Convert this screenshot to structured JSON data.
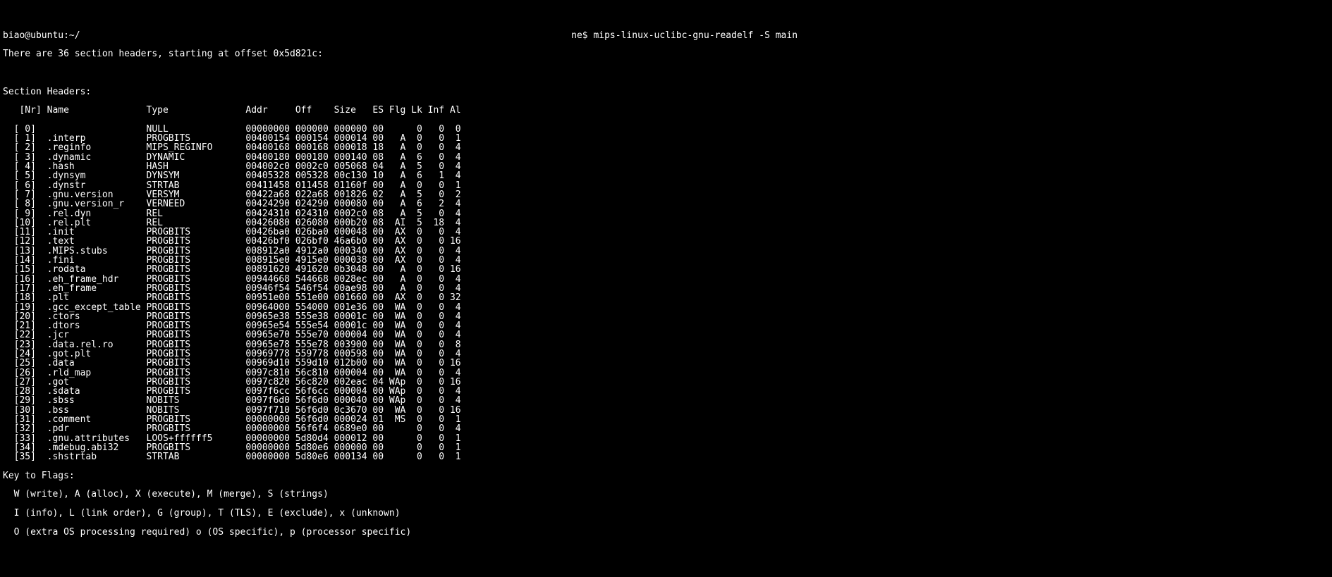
{
  "prompt_line": "biao@ubuntu:~/                                                                                         ne$ mips-linux-uclibc-gnu-readelf -S main",
  "summary_line": "There are 36 section headers, starting at offset 0x5d821c:",
  "section_headers_title": "Section Headers:",
  "header_labels": {
    "nr": "[Nr]",
    "name": "Name",
    "type": "Type",
    "addr": "Addr",
    "off": "Off",
    "size": "Size",
    "es": "ES",
    "flg": "Flg",
    "lk": "Lk",
    "inf": "Inf",
    "al": "Al"
  },
  "sections": [
    {
      "nr": "[ 0]",
      "name": "",
      "type": "NULL",
      "addr": "00000000",
      "off": "000000",
      "size": "000000",
      "es": "00",
      "flg": "",
      "lk": "0",
      "inf": "0",
      "al": "0"
    },
    {
      "nr": "[ 1]",
      "name": ".interp",
      "type": "PROGBITS",
      "addr": "00400154",
      "off": "000154",
      "size": "000014",
      "es": "00",
      "flg": "A",
      "lk": "0",
      "inf": "0",
      "al": "1"
    },
    {
      "nr": "[ 2]",
      "name": ".reginfo",
      "type": "MIPS_REGINFO",
      "addr": "00400168",
      "off": "000168",
      "size": "000018",
      "es": "18",
      "flg": "A",
      "lk": "0",
      "inf": "0",
      "al": "4"
    },
    {
      "nr": "[ 3]",
      "name": ".dynamic",
      "type": "DYNAMIC",
      "addr": "00400180",
      "off": "000180",
      "size": "000140",
      "es": "08",
      "flg": "A",
      "lk": "6",
      "inf": "0",
      "al": "4"
    },
    {
      "nr": "[ 4]",
      "name": ".hash",
      "type": "HASH",
      "addr": "004002c0",
      "off": "0002c0",
      "size": "005068",
      "es": "04",
      "flg": "A",
      "lk": "5",
      "inf": "0",
      "al": "4"
    },
    {
      "nr": "[ 5]",
      "name": ".dynsym",
      "type": "DYNSYM",
      "addr": "00405328",
      "off": "005328",
      "size": "00c130",
      "es": "10",
      "flg": "A",
      "lk": "6",
      "inf": "1",
      "al": "4"
    },
    {
      "nr": "[ 6]",
      "name": ".dynstr",
      "type": "STRTAB",
      "addr": "00411458",
      "off": "011458",
      "size": "01160f",
      "es": "00",
      "flg": "A",
      "lk": "0",
      "inf": "0",
      "al": "1"
    },
    {
      "nr": "[ 7]",
      "name": ".gnu.version",
      "type": "VERSYM",
      "addr": "00422a68",
      "off": "022a68",
      "size": "001826",
      "es": "02",
      "flg": "A",
      "lk": "5",
      "inf": "0",
      "al": "2"
    },
    {
      "nr": "[ 8]",
      "name": ".gnu.version_r",
      "type": "VERNEED",
      "addr": "00424290",
      "off": "024290",
      "size": "000080",
      "es": "00",
      "flg": "A",
      "lk": "6",
      "inf": "2",
      "al": "4"
    },
    {
      "nr": "[ 9]",
      "name": ".rel.dyn",
      "type": "REL",
      "addr": "00424310",
      "off": "024310",
      "size": "0002c0",
      "es": "08",
      "flg": "A",
      "lk": "5",
      "inf": "0",
      "al": "4"
    },
    {
      "nr": "[10]",
      "name": ".rel.plt",
      "type": "REL",
      "addr": "00426080",
      "off": "026080",
      "size": "000b20",
      "es": "08",
      "flg": "AI",
      "lk": "5",
      "inf": "18",
      "al": "4"
    },
    {
      "nr": "[11]",
      "name": ".init",
      "type": "PROGBITS",
      "addr": "00426ba0",
      "off": "026ba0",
      "size": "000048",
      "es": "00",
      "flg": "AX",
      "lk": "0",
      "inf": "0",
      "al": "4"
    },
    {
      "nr": "[12]",
      "name": ".text",
      "type": "PROGBITS",
      "addr": "00426bf0",
      "off": "026bf0",
      "size": "46a6b0",
      "es": "00",
      "flg": "AX",
      "lk": "0",
      "inf": "0",
      "al": "16"
    },
    {
      "nr": "[13]",
      "name": ".MIPS.stubs",
      "type": "PROGBITS",
      "addr": "008912a0",
      "off": "4912a0",
      "size": "000340",
      "es": "00",
      "flg": "AX",
      "lk": "0",
      "inf": "0",
      "al": "4"
    },
    {
      "nr": "[14]",
      "name": ".fini",
      "type": "PROGBITS",
      "addr": "008915e0",
      "off": "4915e0",
      "size": "000038",
      "es": "00",
      "flg": "AX",
      "lk": "0",
      "inf": "0",
      "al": "4"
    },
    {
      "nr": "[15]",
      "name": ".rodata",
      "type": "PROGBITS",
      "addr": "00891620",
      "off": "491620",
      "size": "0b3048",
      "es": "00",
      "flg": "A",
      "lk": "0",
      "inf": "0",
      "al": "16"
    },
    {
      "nr": "[16]",
      "name": ".eh_frame_hdr",
      "type": "PROGBITS",
      "addr": "00944668",
      "off": "544668",
      "size": "0028ec",
      "es": "00",
      "flg": "A",
      "lk": "0",
      "inf": "0",
      "al": "4"
    },
    {
      "nr": "[17]",
      "name": ".eh_frame",
      "type": "PROGBITS",
      "addr": "00946f54",
      "off": "546f54",
      "size": "00ae98",
      "es": "00",
      "flg": "A",
      "lk": "0",
      "inf": "0",
      "al": "4"
    },
    {
      "nr": "[18]",
      "name": ".plt",
      "type": "PROGBITS",
      "addr": "00951e00",
      "off": "551e00",
      "size": "001660",
      "es": "00",
      "flg": "AX",
      "lk": "0",
      "inf": "0",
      "al": "32"
    },
    {
      "nr": "[19]",
      "name": ".gcc_except_table",
      "type": "PROGBITS",
      "addr": "00964000",
      "off": "554000",
      "size": "001e36",
      "es": "00",
      "flg": "WA",
      "lk": "0",
      "inf": "0",
      "al": "4"
    },
    {
      "nr": "[20]",
      "name": ".ctors",
      "type": "PROGBITS",
      "addr": "00965e38",
      "off": "555e38",
      "size": "00001c",
      "es": "00",
      "flg": "WA",
      "lk": "0",
      "inf": "0",
      "al": "4"
    },
    {
      "nr": "[21]",
      "name": ".dtors",
      "type": "PROGBITS",
      "addr": "00965e54",
      "off": "555e54",
      "size": "00001c",
      "es": "00",
      "flg": "WA",
      "lk": "0",
      "inf": "0",
      "al": "4"
    },
    {
      "nr": "[22]",
      "name": ".jcr",
      "type": "PROGBITS",
      "addr": "00965e70",
      "off": "555e70",
      "size": "000004",
      "es": "00",
      "flg": "WA",
      "lk": "0",
      "inf": "0",
      "al": "4"
    },
    {
      "nr": "[23]",
      "name": ".data.rel.ro",
      "type": "PROGBITS",
      "addr": "00965e78",
      "off": "555e78",
      "size": "003900",
      "es": "00",
      "flg": "WA",
      "lk": "0",
      "inf": "0",
      "al": "8"
    },
    {
      "nr": "[24]",
      "name": ".got.plt",
      "type": "PROGBITS",
      "addr": "00969778",
      "off": "559778",
      "size": "000598",
      "es": "00",
      "flg": "WA",
      "lk": "0",
      "inf": "0",
      "al": "4"
    },
    {
      "nr": "[25]",
      "name": ".data",
      "type": "PROGBITS",
      "addr": "00969d10",
      "off": "559d10",
      "size": "012b00",
      "es": "00",
      "flg": "WA",
      "lk": "0",
      "inf": "0",
      "al": "16"
    },
    {
      "nr": "[26]",
      "name": ".rld_map",
      "type": "PROGBITS",
      "addr": "0097c810",
      "off": "56c810",
      "size": "000004",
      "es": "00",
      "flg": "WA",
      "lk": "0",
      "inf": "0",
      "al": "4"
    },
    {
      "nr": "[27]",
      "name": ".got",
      "type": "PROGBITS",
      "addr": "0097c820",
      "off": "56c820",
      "size": "002eac",
      "es": "04",
      "flg": "WAp",
      "lk": "0",
      "inf": "0",
      "al": "16"
    },
    {
      "nr": "[28]",
      "name": ".sdata",
      "type": "PROGBITS",
      "addr": "0097f6cc",
      "off": "56f6cc",
      "size": "000004",
      "es": "00",
      "flg": "WAp",
      "lk": "0",
      "inf": "0",
      "al": "4"
    },
    {
      "nr": "[29]",
      "name": ".sbss",
      "type": "NOBITS",
      "addr": "0097f6d0",
      "off": "56f6d0",
      "size": "000040",
      "es": "00",
      "flg": "WAp",
      "lk": "0",
      "inf": "0",
      "al": "4"
    },
    {
      "nr": "[30]",
      "name": ".bss",
      "type": "NOBITS",
      "addr": "0097f710",
      "off": "56f6d0",
      "size": "0c3670",
      "es": "00",
      "flg": "WA",
      "lk": "0",
      "inf": "0",
      "al": "16"
    },
    {
      "nr": "[31]",
      "name": ".comment",
      "type": "PROGBITS",
      "addr": "00000000",
      "off": "56f6d0",
      "size": "000024",
      "es": "01",
      "flg": "MS",
      "lk": "0",
      "inf": "0",
      "al": "1"
    },
    {
      "nr": "[32]",
      "name": ".pdr",
      "type": "PROGBITS",
      "addr": "00000000",
      "off": "56f6f4",
      "size": "0689e0",
      "es": "00",
      "flg": "",
      "lk": "0",
      "inf": "0",
      "al": "4"
    },
    {
      "nr": "[33]",
      "name": ".gnu.attributes",
      "type": "LOOS+ffffff5",
      "addr": "00000000",
      "off": "5d80d4",
      "size": "000012",
      "es": "00",
      "flg": "",
      "lk": "0",
      "inf": "0",
      "al": "1"
    },
    {
      "nr": "[34]",
      "name": ".mdebug.abi32",
      "type": "PROGBITS",
      "addr": "00000000",
      "off": "5d80e6",
      "size": "000000",
      "es": "00",
      "flg": "",
      "lk": "0",
      "inf": "0",
      "al": "1"
    },
    {
      "nr": "[35]",
      "name": ".shstrtab",
      "type": "STRTAB",
      "addr": "00000000",
      "off": "5d80e6",
      "size": "000134",
      "es": "00",
      "flg": "",
      "lk": "0",
      "inf": "0",
      "al": "1"
    }
  ],
  "key_to_flags_title": "Key to Flags:",
  "flags_line1": "  W (write), A (alloc), X (execute), M (merge), S (strings)",
  "flags_line2": "  I (info), L (link order), G (group), T (TLS), E (exclude), x (unknown)",
  "flags_line3": "  O (extra OS processing required) o (OS specific), p (processor specific)"
}
